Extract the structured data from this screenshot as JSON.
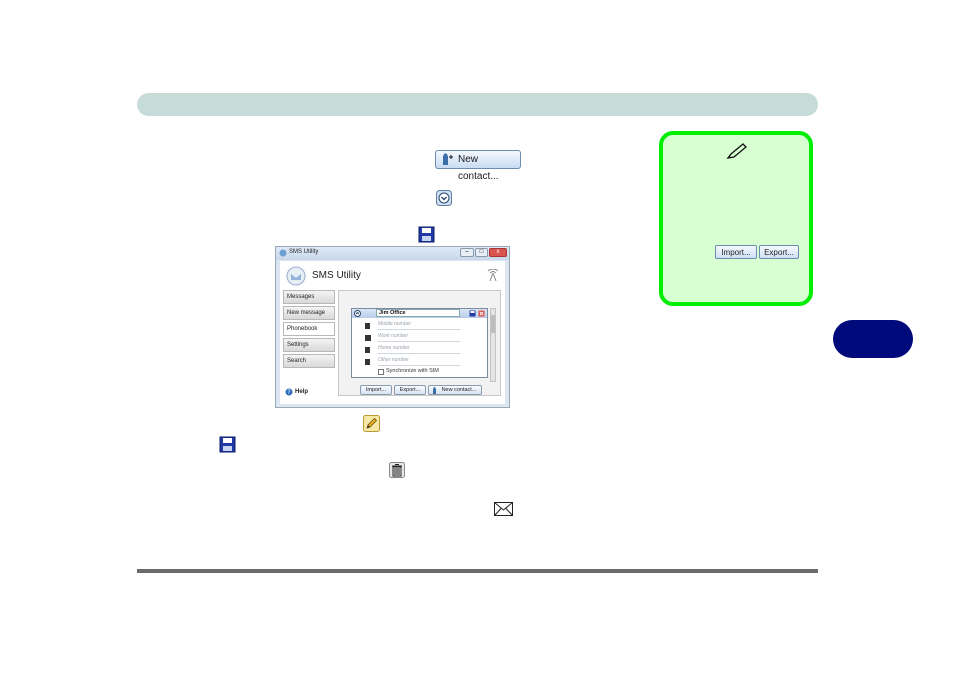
{
  "note": {
    "import_label": "Import...",
    "export_label": "Export..."
  },
  "inline_buttons": {
    "new_contact_label": "New contact..."
  },
  "app": {
    "window_title": "SMS Utility",
    "app_title": "SMS Utility",
    "nav": [
      "Messages",
      "New message",
      "Phonebook",
      "Settings",
      "Search"
    ],
    "help_label": "Help",
    "contact_name": "Jim Office",
    "fields": [
      "Mobile number",
      "Work number",
      "Home number",
      "Other number"
    ],
    "sync_label": "Synchronize with SIM",
    "import_label": "Import...",
    "export_label": "Export...",
    "new_contact_label": "New contact..."
  },
  "colors": {
    "header_bar": "#c7dcd9",
    "note_border": "#00ee00",
    "note_bg": "#d7ffd2",
    "chapter_tab": "#000a7a"
  }
}
